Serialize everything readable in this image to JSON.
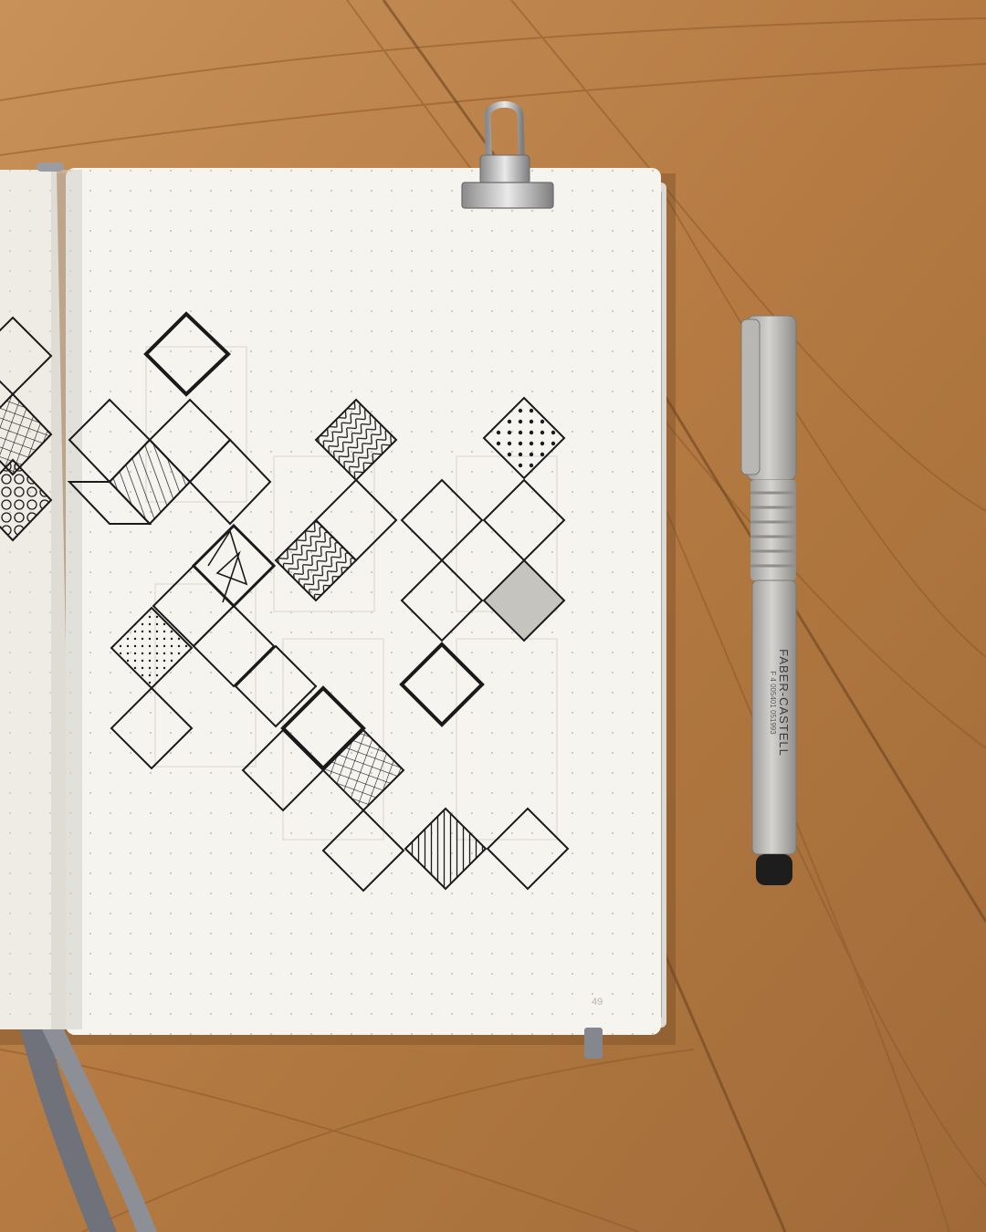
{
  "scene": {
    "description_colors": {
      "wood_light": "#c99256",
      "wood_mid": "#b77e45",
      "wood_dark": "#8f5a2c",
      "paper": "#f6f4ef",
      "paper_edge": "#dcd9d2",
      "ink": "#1a1a1a",
      "pencil_ghost": "#dedbd4",
      "clip_metal": "#c9c9c9",
      "pen_body": "#bdbcb8",
      "ribbon": "#7d7f86"
    },
    "page_number": "49",
    "pen_brand": "FABER-CASTELL",
    "pen_small_print": "F 4 005401 051993"
  }
}
